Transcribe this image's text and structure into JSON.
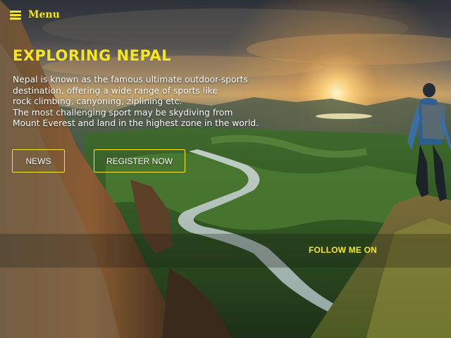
{
  "nav": {
    "menu_icon": "hamburger-menu-icon",
    "menu_label": "Menu"
  },
  "hero": {
    "title": "EXPLORING NEPAL",
    "description_lines": [
      "Nepal is known as the famous ultimate outdoor-sports",
      "destination, offering a wide range of sports like",
      "rock climbing, canyoning, ziplining etc.",
      "The most challenging sport may be skydiving from",
      "Mount Everest and land in the highest zone in the world."
    ]
  },
  "buttons": {
    "news_label": "NEWS",
    "register_label": "REGISTER NOW"
  },
  "social": {
    "follow_label": "FOLLOW ME ON"
  },
  "colors": {
    "accent": "#f5e623",
    "text": "#ffffff"
  }
}
